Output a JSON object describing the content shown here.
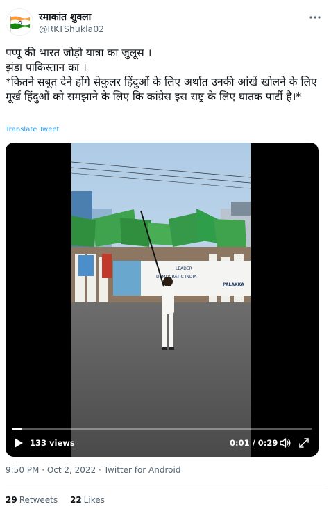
{
  "user": {
    "display_name": "रमाकांत शुक्ला",
    "handle": "@RKTShukla02"
  },
  "icons": {
    "avatar": "india-flag",
    "more": "more-options-icon",
    "play": "play-icon",
    "volume": "volume-icon",
    "fullscreen": "fullscreen-icon"
  },
  "tweet": {
    "lines": [
      "पप्पू की भारत जोड़ो यात्रा का जुलूस ।",
      "झंडा पाकिस्तान का ।",
      "*कितने सबूत देने होंगे सेकुलर हिंदुओं के लिए अर्थात उनकी आंखें खोलने के लिए मूर्ख हिंदुओं को समझाने के लिए कि कांग्रेस इस राष्ट्र के लिए घातक पार्टी है।*"
    ],
    "translate_label": "Translate Tweet"
  },
  "video": {
    "views": "133 views",
    "time": "0:01 / 0:29",
    "progress": 0.03,
    "banner_text": [
      "LEADER",
      "DEMOCRATIC INDIA",
      "PALAKKA"
    ]
  },
  "meta": {
    "time": "9:50 PM",
    "date": "Oct 2, 2022",
    "source": "Twitter for Android",
    "separator": "·"
  },
  "stats": {
    "retweets_count": "29",
    "retweets_label": "Retweets",
    "likes_count": "22",
    "likes_label": "Likes"
  },
  "colors": {
    "link": "#1d9bf0",
    "secondary_text": "#536471",
    "flag_green": "#2e9e4a"
  }
}
